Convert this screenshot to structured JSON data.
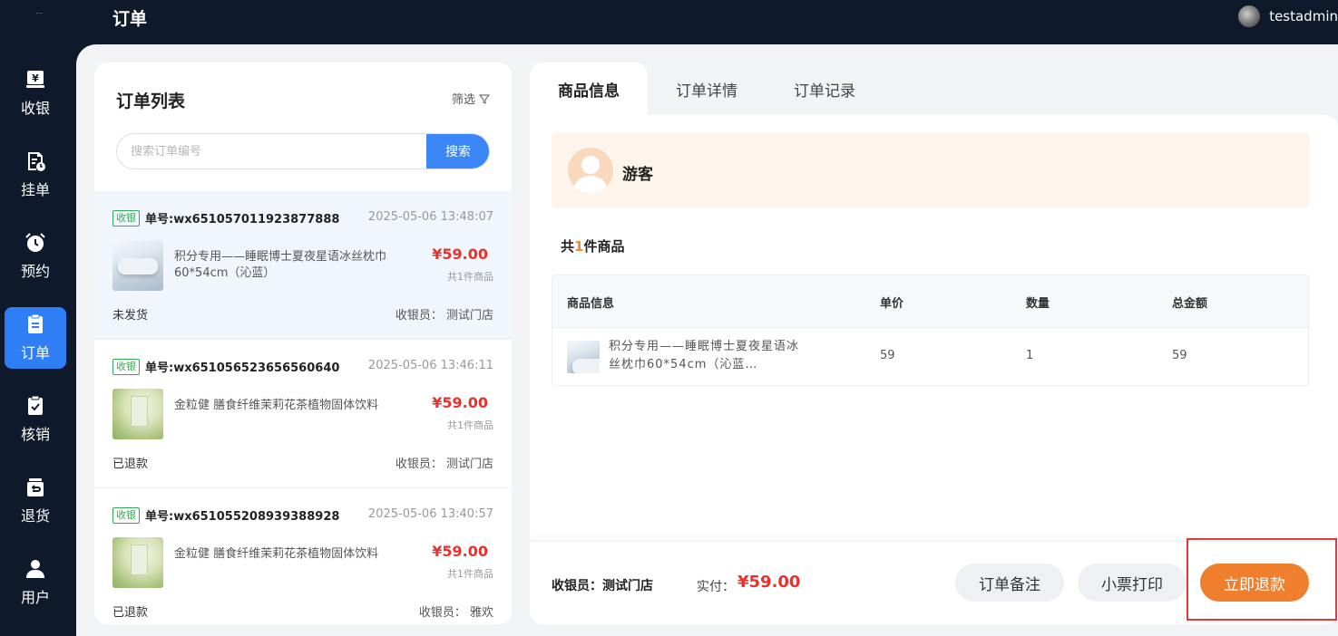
{
  "header": {
    "logo_text": "…",
    "title": "订单",
    "username": "testadmin"
  },
  "sidebar": {
    "items": [
      {
        "label": "收银",
        "icon": "yen-register-icon"
      },
      {
        "label": "挂单",
        "icon": "hold-order-icon"
      },
      {
        "label": "预约",
        "icon": "alarm-clock-icon"
      },
      {
        "label": "订单",
        "icon": "clipboard-icon",
        "active": true
      },
      {
        "label": "核销",
        "icon": "check-clipboard-icon"
      },
      {
        "label": "退货",
        "icon": "return-icon"
      },
      {
        "label": "用户",
        "icon": "user-icon"
      }
    ]
  },
  "order_list": {
    "title": "订单列表",
    "filter_label": "筛选",
    "search": {
      "placeholder": "搜索订单编号",
      "value": "",
      "button": "搜索"
    },
    "orders": [
      {
        "badge": "收银",
        "order_no": "单号:wx651057011923877888",
        "time": "2025-05-06 13:48:07",
        "item_name": "积分专用——睡眠博士夏夜星语冰丝枕巾60*54cm（沁蓝）",
        "price": "¥59.00",
        "count": "共1件商品",
        "status": "未发货",
        "cashier": "收银员： 测试门店"
      },
      {
        "badge": "收银",
        "order_no": "单号:wx651056523656560640",
        "time": "2025-05-06 13:46:11",
        "item_name": "金粒健 膳食纤维茉莉花茶植物固体饮料",
        "price": "¥59.00",
        "count": "共1件商品",
        "status": "已退款",
        "cashier": "收银员： 测试门店"
      },
      {
        "badge": "收银",
        "order_no": "单号:wx651055208939388928",
        "time": "2025-05-06 13:40:57",
        "item_name": "金粒健 膳食纤维茉莉花茶植物固体饮料",
        "price": "¥59.00",
        "count": "共1件商品",
        "status": "已退款",
        "cashier": "收银员： 雅欢"
      }
    ]
  },
  "detail": {
    "tabs": [
      "商品信息",
      "订单详情",
      "订单记录"
    ],
    "customer_name": "游客",
    "goods_count": {
      "prefix": "共",
      "num": "1",
      "suffix": "件商品"
    },
    "table": {
      "headers": [
        "商品信息",
        "单价",
        "数量",
        "总金额"
      ],
      "rows": [
        {
          "name": "积分专用——睡眠博士夏夜星语冰丝枕巾60*54cm（沁蓝…",
          "price": "59",
          "qty": "1",
          "total": "59"
        }
      ]
    },
    "footer": {
      "cashier": "收银员：测试门店",
      "paid_label": "实付：",
      "paid_value": "¥59.00",
      "btn_note": "订单备注",
      "btn_print": "小票打印",
      "btn_refund": "立即退款"
    }
  },
  "colors": {
    "sidebar_bg": "#0e1a2b",
    "active": "#2f7ef5",
    "price": "#e8322b",
    "refund": "#f07f2d"
  }
}
